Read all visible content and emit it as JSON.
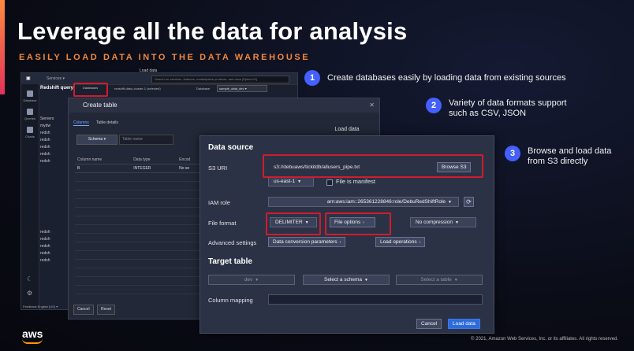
{
  "slide": {
    "title": "Leverage all the data for analysis",
    "subtitle": "EASILY LOAD DATA INTO THE DATA WAREHOUSE",
    "copyright": "© 2021, Amazon Web Services, Inc. or its affiliates. All rights reserved.",
    "logo": "aws",
    "colors": {
      "accent_orange": "#f0873d",
      "badge_blue": "#4460ff",
      "highlight_red": "#d01c2c"
    }
  },
  "callouts": [
    {
      "number": "1",
      "text": "Create databases easily by loading data from existing sources"
    },
    {
      "number": "2",
      "text_line1": "Variety of data formats support",
      "text_line2": "such as CSV, JSON"
    },
    {
      "number": "3",
      "text_line1": "Browse and load data",
      "text_line2": "from S3 directly"
    }
  ],
  "console": {
    "header_title": "Load data",
    "services_label": "Services ▾",
    "search_placeholder": "Search for services, features, marketplace products, and docs   [Option+S]",
    "app_name": "Redshift query",
    "side_labels": [
      "Database",
      "Queries",
      "Charts"
    ],
    "databases_tab": "Databases",
    "cluster_text": "redshift-dabu-cluster-1   (selected)",
    "database_label": "Database",
    "database_value": "sample_data_dev ▾",
    "tree_items": [
      "Servers",
      "mydw",
      "redsh",
      "redsh",
      "redsh",
      "redsh",
      "redsh",
      "",
      "",
      "",
      "",
      "",
      "",
      "",
      "",
      "",
      "redsh",
      "redsh",
      "redsh",
      "redsh",
      "redsh"
    ],
    "footer_left": "Feedback   English (US) ▾"
  },
  "create_table": {
    "title": "Create table",
    "close": "✕",
    "tabs": [
      "Columns",
      "Table details"
    ],
    "schema_label": "Schema ▾",
    "table_name_placeholder": "Table name",
    "columns": [
      "Column name",
      "Data type",
      "Encod"
    ],
    "row": [
      "B",
      "INTEGER",
      "No se"
    ],
    "cancel": "Cancel",
    "reset": "Reset"
  },
  "load_data": {
    "title": "Load data",
    "data_source_heading": "Data source",
    "s3_uri_label": "S3 URI",
    "s3_uri_value": "s3://debuaws/tickitdb/allusers_pipe.txt",
    "browse_s3": "Browse S3",
    "region": "us-east-1",
    "file_is_manifest": "File is manifest",
    "iam_role_label": "IAM role",
    "iam_role_value": "arn:aws:iam::265361228846:role/DebuRedShiftRole",
    "file_format_label": "File format",
    "file_format_value": "DELIMITER",
    "file_options": "File options",
    "compression": "No compression",
    "advanced_settings_label": "Advanced settings",
    "data_conversion": "Data conversion parameters",
    "load_operations": "Load operations",
    "target_table_heading": "Target table",
    "target_db": "dev",
    "select_schema": "Select a schema",
    "select_table": "Select a table",
    "column_mapping_label": "Column mapping",
    "cancel": "Cancel",
    "load_data_button": "Load data"
  }
}
